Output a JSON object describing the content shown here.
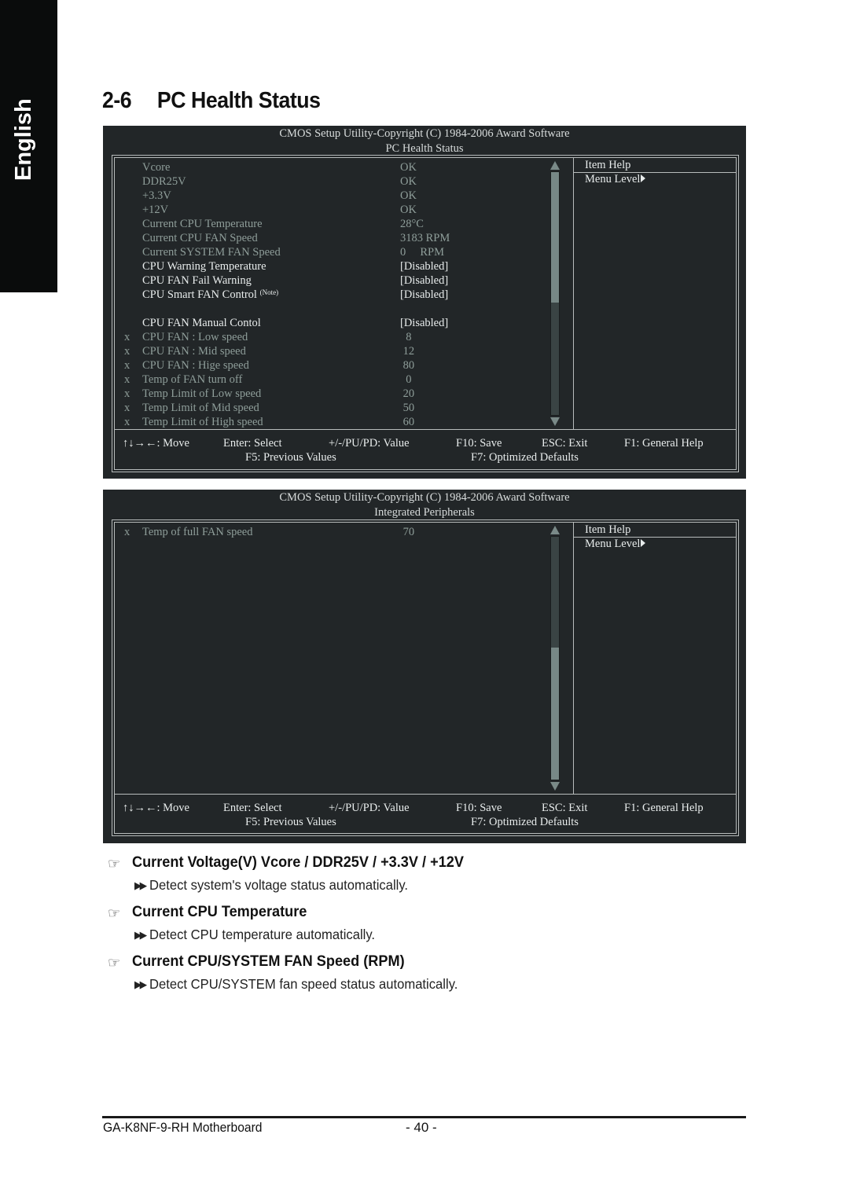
{
  "language_tab": "English",
  "section": {
    "number": "2-6",
    "title": "PC Health Status"
  },
  "screens": [
    {
      "header_line1": "CMOS Setup Utility-Copyright (C) 1984-2006 Award Software",
      "header_line2": "PC Health Status",
      "rows": [
        {
          "x": "",
          "label": "Vcore",
          "value": "OK",
          "state": "dim"
        },
        {
          "x": "",
          "label": "DDR25V",
          "value": "OK",
          "state": "dim"
        },
        {
          "x": "",
          "label": "+3.3V",
          "value": "OK",
          "state": "dim"
        },
        {
          "x": "",
          "label": "+12V",
          "value": "OK",
          "state": "dim"
        },
        {
          "x": "",
          "label": "Current CPU Temperature",
          "value": "28°C",
          "state": "dim"
        },
        {
          "x": "",
          "label": "Current CPU FAN Speed",
          "value": "3183 RPM",
          "state": "dim"
        },
        {
          "x": "",
          "label": "Current SYSTEM FAN Speed",
          "value": "0     RPM",
          "state": "dim"
        },
        {
          "x": "",
          "label": "CPU Warning Temperature",
          "value": "[Disabled]",
          "state": "on"
        },
        {
          "x": "",
          "label": "CPU FAN Fail Warning",
          "value": "[Disabled]",
          "state": "on"
        },
        {
          "x": "",
          "label": "CPU Smart FAN Control",
          "note": "(Note)",
          "value": "[Disabled]",
          "state": "on"
        },
        {
          "x": "",
          "label": "",
          "value": "",
          "state": "on"
        },
        {
          "x": "",
          "label": "CPU FAN Manual Contol",
          "value": "[Disabled]",
          "state": "on"
        },
        {
          "x": "x",
          "label": "CPU FAN : Low speed",
          "value": "  8",
          "state": "dim"
        },
        {
          "x": "x",
          "label": "CPU FAN : Mid speed",
          "value": " 12",
          "state": "dim"
        },
        {
          "x": "x",
          "label": "CPU FAN : Hige speed",
          "value": " 80",
          "state": "dim"
        },
        {
          "x": "x",
          "label": "Temp of FAN turn off",
          "value": "  0",
          "state": "dim"
        },
        {
          "x": "x",
          "label": "Temp Limit of Low speed",
          "value": " 20",
          "state": "dim"
        },
        {
          "x": "x",
          "label": "Temp Limit of Mid speed",
          "value": " 50",
          "state": "dim"
        },
        {
          "x": "x",
          "label": "Temp Limit of High speed",
          "value": " 60",
          "state": "dim"
        }
      ],
      "scroll_position": "top",
      "help_title": "Item Help",
      "help_menu": "Menu Level"
    },
    {
      "header_line1": "CMOS Setup Utility-Copyright (C) 1984-2006 Award Software",
      "header_line2": "Integrated Peripherals",
      "rows": [
        {
          "x": "x",
          "label": "Temp of full FAN speed",
          "value": " 70",
          "state": "dim"
        }
      ],
      "scroll_position": "bottom",
      "help_title": "Item Help",
      "help_menu": "Menu Level"
    }
  ],
  "keys": {
    "move": "↑↓→←: Move",
    "select": "Enter: Select",
    "value": "+/-/PU/PD: Value",
    "save": "F10: Save",
    "exit": "ESC: Exit",
    "help": "F1: General Help",
    "previous": "F5: Previous Values",
    "optimized": "F7: Optimized Defaults"
  },
  "descriptions": [
    {
      "title": "Current Voltage(V) Vcore / DDR25V / +3.3V / +12V",
      "text": "Detect system's voltage status automatically."
    },
    {
      "title": "Current CPU Temperature",
      "text": "Detect CPU temperature automatically."
    },
    {
      "title": "Current CPU/SYSTEM FAN Speed (RPM)",
      "text": "Detect CPU/SYSTEM fan speed status automatically."
    }
  ],
  "footer": {
    "model": "GA-K8NF-9-RH Motherboard",
    "page": "- 40 -"
  }
}
